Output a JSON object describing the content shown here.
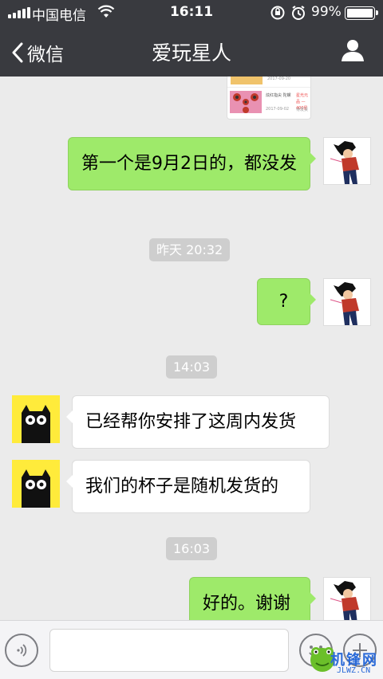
{
  "status_bar": {
    "carrier": "中国电信",
    "time": "16:11",
    "battery_percent": "99%",
    "battery_level": 0.99
  },
  "nav": {
    "back_label": "微信",
    "title": "爱玩星人"
  },
  "preview_card": {
    "date1": "2017-09-20",
    "item_text": "炫红指尖 陀螺",
    "price": "星光元品 —400星",
    "date2": "2017-09-02",
    "status2": "待发货"
  },
  "messages": [
    {
      "side": "right",
      "text": "第一个是9月2日的，都没发"
    },
    {
      "type": "time",
      "text": "昨天 20:32"
    },
    {
      "side": "right",
      "text": "?"
    },
    {
      "type": "time",
      "text": "14:03"
    },
    {
      "side": "left",
      "text": "已经帮你安排了这周内发货"
    },
    {
      "side": "left",
      "text": "我们的杯子是随机发货的"
    },
    {
      "type": "time",
      "text": "16:03"
    },
    {
      "side": "right",
      "text": "好的。谢谢"
    }
  ],
  "watermark": {
    "cn": "机锋网",
    "url": "JLWZ.CN"
  },
  "colors": {
    "bar": "#393a3f",
    "bubble_self": "#9eea6a",
    "bubble_other": "#ffffff",
    "background": "#ebebeb",
    "owl_bg": "#ffeb3b"
  }
}
